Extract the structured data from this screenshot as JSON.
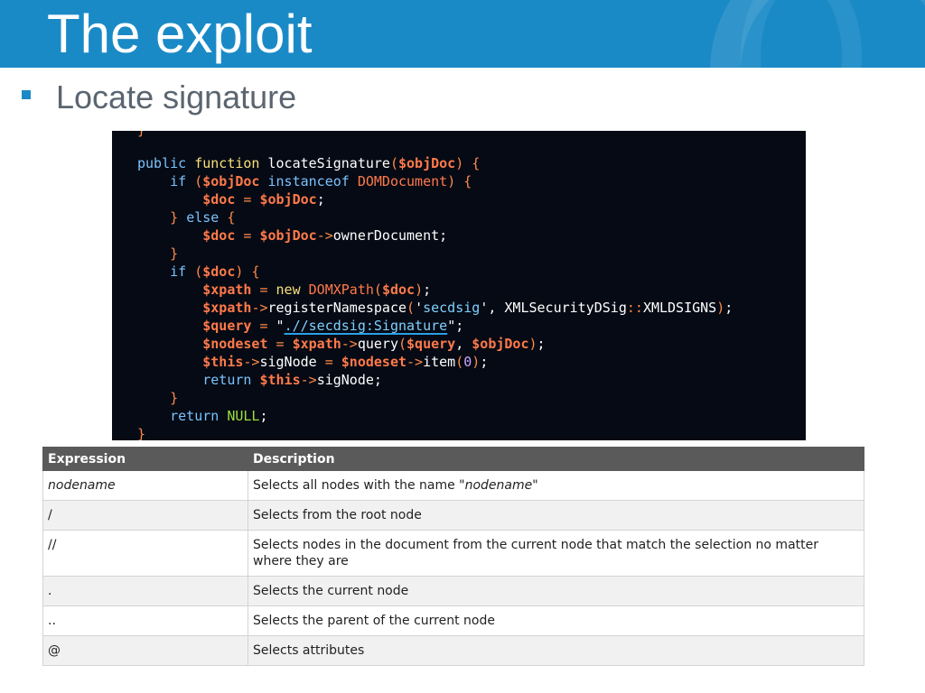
{
  "slide": {
    "title": "The exploit",
    "bullet": "Locate signature"
  },
  "code": {
    "lines": [
      {
        "indent": "",
        "tokens": [
          [
            "kw",
            "public"
          ],
          [
            "",
            " "
          ],
          [
            "fn",
            "function"
          ],
          [
            "",
            " "
          ],
          [
            "",
            "locateSignature"
          ],
          [
            "op",
            "("
          ],
          [
            "var",
            "$objDoc"
          ],
          [
            "op",
            ")"
          ],
          [
            "",
            " "
          ],
          [
            "op",
            "{"
          ]
        ]
      },
      {
        "indent": "    ",
        "tokens": [
          [
            "kw",
            "if"
          ],
          [
            "",
            " "
          ],
          [
            "op",
            "("
          ],
          [
            "var",
            "$objDoc"
          ],
          [
            "",
            " "
          ],
          [
            "kw",
            "instanceof"
          ],
          [
            "",
            " "
          ],
          [
            "cls",
            "DOMDocument"
          ],
          [
            "op",
            ")"
          ],
          [
            "",
            " "
          ],
          [
            "op",
            "{"
          ]
        ]
      },
      {
        "indent": "        ",
        "tokens": [
          [
            "var",
            "$doc"
          ],
          [
            "",
            " "
          ],
          [
            "op",
            "="
          ],
          [
            "",
            " "
          ],
          [
            "var",
            "$objDoc"
          ],
          [
            "",
            ";"
          ]
        ]
      },
      {
        "indent": "    ",
        "tokens": [
          [
            "op",
            "}"
          ],
          [
            "",
            " "
          ],
          [
            "kw",
            "else"
          ],
          [
            "",
            " "
          ],
          [
            "op",
            "{"
          ]
        ]
      },
      {
        "indent": "        ",
        "tokens": [
          [
            "var",
            "$doc"
          ],
          [
            "",
            " "
          ],
          [
            "op",
            "="
          ],
          [
            "",
            " "
          ],
          [
            "var",
            "$objDoc"
          ],
          [
            "op",
            "->"
          ],
          [
            "",
            "ownerDocument;"
          ]
        ]
      },
      {
        "indent": "    ",
        "tokens": [
          [
            "op",
            "}"
          ]
        ]
      },
      {
        "indent": "    ",
        "tokens": [
          [
            "kw",
            "if"
          ],
          [
            "",
            " "
          ],
          [
            "op",
            "("
          ],
          [
            "var",
            "$doc"
          ],
          [
            "op",
            ")"
          ],
          [
            "",
            " "
          ],
          [
            "op",
            "{"
          ]
        ]
      },
      {
        "indent": "        ",
        "tokens": [
          [
            "var",
            "$xpath"
          ],
          [
            "",
            " "
          ],
          [
            "op",
            "="
          ],
          [
            "",
            " "
          ],
          [
            "fn",
            "new"
          ],
          [
            "",
            " "
          ],
          [
            "cls",
            "DOMXPath"
          ],
          [
            "op",
            "("
          ],
          [
            "var",
            "$doc"
          ],
          [
            "op",
            ")"
          ],
          [
            "",
            ";"
          ]
        ]
      },
      {
        "indent": "        ",
        "tokens": [
          [
            "var",
            "$xpath"
          ],
          [
            "op",
            "->"
          ],
          [
            "",
            "registerNamespace"
          ],
          [
            "op",
            "("
          ],
          [
            "",
            "'"
          ],
          [
            "str",
            "secdsig"
          ],
          [
            "",
            "', XMLSecurityDSig"
          ],
          [
            "op",
            "::"
          ],
          [
            "",
            "XMLDSIGNS"
          ],
          [
            "op",
            ")"
          ],
          [
            "",
            ";"
          ]
        ]
      },
      {
        "indent": "        ",
        "tokens": [
          [
            "var",
            "$query"
          ],
          [
            "",
            " "
          ],
          [
            "op",
            "="
          ],
          [
            "",
            " \""
          ],
          [
            "str ul",
            ".//secdsig:Signature"
          ],
          [
            "",
            "\";"
          ]
        ]
      },
      {
        "indent": "        ",
        "tokens": [
          [
            "var",
            "$nodeset"
          ],
          [
            "",
            " "
          ],
          [
            "op",
            "="
          ],
          [
            "",
            " "
          ],
          [
            "var",
            "$xpath"
          ],
          [
            "op",
            "->"
          ],
          [
            "",
            "query"
          ],
          [
            "op",
            "("
          ],
          [
            "var",
            "$query"
          ],
          [
            "",
            ", "
          ],
          [
            "var",
            "$objDoc"
          ],
          [
            "op",
            ")"
          ],
          [
            "",
            ";"
          ]
        ]
      },
      {
        "indent": "        ",
        "tokens": [
          [
            "var",
            "$this"
          ],
          [
            "op",
            "->"
          ],
          [
            "",
            "sigNode"
          ],
          [
            "",
            " "
          ],
          [
            "op",
            "="
          ],
          [
            "",
            " "
          ],
          [
            "var",
            "$nodeset"
          ],
          [
            "op",
            "->"
          ],
          [
            "",
            "item"
          ],
          [
            "op",
            "("
          ],
          [
            "num",
            "0"
          ],
          [
            "op",
            ")"
          ],
          [
            "",
            ";"
          ]
        ]
      },
      {
        "indent": "        ",
        "tokens": [
          [
            "kw",
            "return"
          ],
          [
            "",
            " "
          ],
          [
            "var",
            "$this"
          ],
          [
            "op",
            "->"
          ],
          [
            "",
            "sigNode;"
          ]
        ]
      },
      {
        "indent": "    ",
        "tokens": [
          [
            "op",
            "}"
          ]
        ]
      },
      {
        "indent": "    ",
        "tokens": [
          [
            "kw",
            "return"
          ],
          [
            "",
            " "
          ],
          [
            "cst",
            "NULL"
          ],
          [
            "",
            ";"
          ]
        ]
      },
      {
        "indent": "",
        "tokens": [
          [
            "op",
            "}"
          ]
        ]
      }
    ]
  },
  "table": {
    "headers": [
      "Expression",
      "Description"
    ],
    "rows": [
      {
        "expr": "nodename",
        "expr_italic": true,
        "desc_pre": "Selects all nodes with the name \"",
        "desc_it": "nodename",
        "desc_post": "\""
      },
      {
        "expr": "/",
        "desc_pre": "Selects from the root node"
      },
      {
        "expr": "//",
        "desc_pre": "Selects nodes in the document from the current node that match the selection no matter where they are"
      },
      {
        "expr": ".",
        "desc_pre": "Selects the current node"
      },
      {
        "expr": "..",
        "desc_pre": "Selects the parent of the current node"
      },
      {
        "expr": "@",
        "desc_pre": "Selects attributes"
      }
    ]
  }
}
